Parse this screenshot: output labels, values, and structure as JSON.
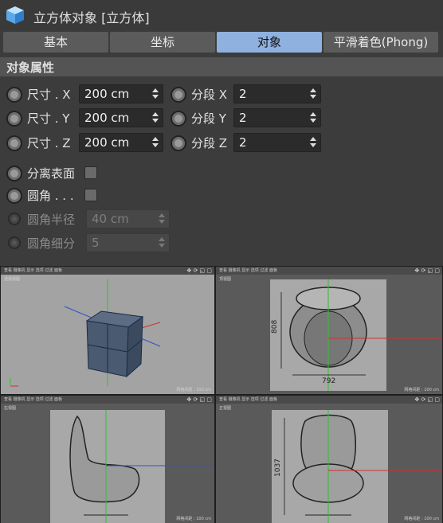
{
  "window": {
    "title": "立方体对象 [立方体]"
  },
  "tabs": [
    {
      "label": "基本",
      "active": false
    },
    {
      "label": "坐标",
      "active": false
    },
    {
      "label": "对象",
      "active": true
    },
    {
      "label": "平滑着色(Phong)",
      "active": false
    }
  ],
  "section": {
    "title": "对象属性"
  },
  "fields": {
    "size_x": {
      "label": "尺寸 . X",
      "value": "200 cm"
    },
    "size_y": {
      "label": "尺寸 . Y",
      "value": "200 cm"
    },
    "size_z": {
      "label": "尺寸 . Z",
      "value": "200 cm"
    },
    "seg_x": {
      "label": "分段 X",
      "value": "2"
    },
    "seg_y": {
      "label": "分段 Y",
      "value": "2"
    },
    "seg_z": {
      "label": "分段 Z",
      "value": "2"
    },
    "separate_surfaces": {
      "label": "分离表面"
    },
    "fillet": {
      "label": "圆角 . . ."
    },
    "fillet_radius": {
      "label": "圆角半径",
      "value": "40 cm"
    },
    "fillet_subdiv": {
      "label": "圆角细分",
      "value": "5"
    }
  },
  "viewports": {
    "menu": "查看  摄像机  显示  选项  过滤  面板",
    "perspective": {
      "label": "透视视图",
      "footer": "网格间距 : 100 cm"
    },
    "top": {
      "label": "顶视图",
      "footer": "网格间距 : 100 cm",
      "dim_height": "808",
      "dim_width": "792"
    },
    "right": {
      "label": "右视图",
      "footer": "网格间距 : 100 cm"
    },
    "front": {
      "label": "正视图",
      "footer": "网格间距 : 100 cm",
      "dim_height": "1037"
    },
    "nav_icons": "✥ ⟳ ◱ ▢"
  },
  "colors": {
    "tab_active": "#8fb1e0",
    "axis_x": "#d03030",
    "axis_y": "#30c030",
    "axis_z": "#3050d0"
  }
}
